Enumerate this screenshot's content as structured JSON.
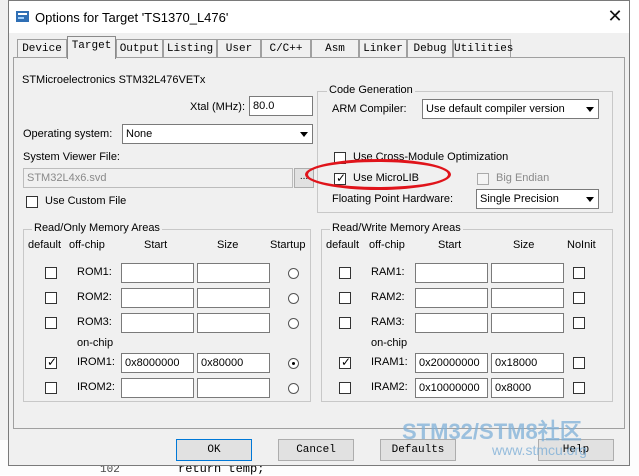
{
  "window": {
    "title": "Options for Target 'TS1370_L476'",
    "close_label": "✕"
  },
  "tabs": [
    "Device",
    "Target",
    "Output",
    "Listing",
    "User",
    "C/C++",
    "Asm",
    "Linker",
    "Debug",
    "Utilities"
  ],
  "active_tab": "Target",
  "target": {
    "device_name": "STMicroelectronics STM32L476VETx",
    "xtal_label": "Xtal (MHz):",
    "xtal_value": "80.0",
    "os_label": "Operating system:",
    "os_value": "None",
    "svd_label": "System Viewer File:",
    "svd_value": "STM32L4x6.svd",
    "browse_label": "...",
    "custom_file_label": "Use Custom File",
    "custom_file_checked": false
  },
  "codegen": {
    "legend": "Code Generation",
    "arm_compiler_label": "ARM Compiler:",
    "arm_compiler_value": "Use default compiler version",
    "cross_module_label": "Use Cross-Module Optimization",
    "cross_module_checked": false,
    "microlib_label": "Use MicroLIB",
    "microlib_checked": true,
    "big_endian_label": "Big Endian",
    "big_endian_checked": false,
    "fp_label": "Floating Point Hardware:",
    "fp_value": "Single Precision"
  },
  "ro_memory": {
    "legend": "Read/Only Memory Areas",
    "headers": {
      "default": "default",
      "offchip": "off-chip",
      "start": "Start",
      "size": "Size",
      "startup": "Startup"
    },
    "onchip_label": "on-chip",
    "rows": [
      {
        "name": "ROM1:",
        "start": "",
        "size": "",
        "default": false,
        "startup": false
      },
      {
        "name": "ROM2:",
        "start": "",
        "size": "",
        "default": false,
        "startup": false
      },
      {
        "name": "ROM3:",
        "start": "",
        "size": "",
        "default": false,
        "startup": false
      },
      {
        "name": "IROM1:",
        "start": "0x8000000",
        "size": "0x80000",
        "default": true,
        "startup": true
      },
      {
        "name": "IROM2:",
        "start": "",
        "size": "",
        "default": false,
        "startup": false
      }
    ]
  },
  "rw_memory": {
    "legend": "Read/Write Memory Areas",
    "headers": {
      "default": "default",
      "offchip": "off-chip",
      "start": "Start",
      "size": "Size",
      "noinit": "NoInit"
    },
    "onchip_label": "on-chip",
    "rows": [
      {
        "name": "RAM1:",
        "start": "",
        "size": "",
        "default": false,
        "noinit": false
      },
      {
        "name": "RAM2:",
        "start": "",
        "size": "",
        "default": false,
        "noinit": false
      },
      {
        "name": "RAM3:",
        "start": "",
        "size": "",
        "default": false,
        "noinit": false
      },
      {
        "name": "IRAM1:",
        "start": "0x20000000",
        "size": "0x18000",
        "default": true,
        "noinit": false
      },
      {
        "name": "IRAM2:",
        "start": "0x10000000",
        "size": "0x8000",
        "default": false,
        "noinit": false
      }
    ]
  },
  "buttons": {
    "ok": "OK",
    "cancel": "Cancel",
    "defaults": "Defaults",
    "help": "Help"
  },
  "background": {
    "line_number": "102",
    "code": "return temp;"
  },
  "watermark": {
    "line1": "STM32/STM8社区",
    "line2": "www.stmcu.org"
  },
  "colors": {
    "highlight": "#e0141b",
    "focus": "#0078d7"
  }
}
